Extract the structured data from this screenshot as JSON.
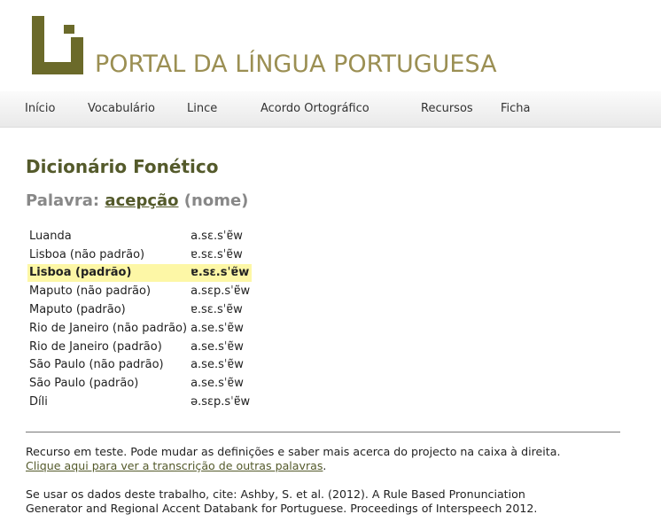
{
  "header": {
    "site_title": "PORTAL DA LÍNGUA PORTUGUESA",
    "brand_color": "#6b6a2a",
    "title_color": "#9b8f53"
  },
  "nav": {
    "items": [
      {
        "label": "Início"
      },
      {
        "label": "Vocabulário"
      },
      {
        "label": "Lince"
      },
      {
        "label": "Acordo Ortográfico"
      },
      {
        "label": "Recursos"
      },
      {
        "label": "Ficha"
      }
    ]
  },
  "main": {
    "page_title": "Dicionário Fonético",
    "word_label": "Palavra:",
    "word": "acepção",
    "word_class": "(nome)",
    "rows": [
      {
        "region": "Luanda",
        "transcription": "a.sɛ.sˈɐ̃w"
      },
      {
        "region": "Lisboa (não padrão)",
        "transcription": "ɐ.sɛ.sˈɐ̃w"
      },
      {
        "region": "Lisboa (padrão)",
        "transcription": "ɐ.sɛ.sˈɐ̃w",
        "highlighted": true
      },
      {
        "region": "Maputo (não padrão)",
        "transcription": "a.sɛp.sˈɐ̃w"
      },
      {
        "region": "Maputo (padrão)",
        "transcription": "ɐ.sɛ.sˈɐ̃w"
      },
      {
        "region": "Rio de Janeiro (não padrão)",
        "transcription": "a.se.sˈɐ̃w"
      },
      {
        "region": "Rio de Janeiro (padrão)",
        "transcription": "a.se.sˈɐ̃w"
      },
      {
        "region": "São Paulo (não padrão)",
        "transcription": "a.se.sˈɐ̃w"
      },
      {
        "region": "São Paulo (padrão)",
        "transcription": "a.se.sˈɐ̃w"
      },
      {
        "region": "Díli",
        "transcription": "ə.sɛp.sˈɐ̃w"
      }
    ],
    "highlight_color": "#fdf7a6"
  },
  "footer": {
    "note": "Recurso em teste. Pode mudar as definições e saber mais acerca do projecto na caixa à direita.",
    "link_text": "Clique aqui para ver a transcrição de outras palavras",
    "link_suffix": ".",
    "cite_line1": "Se usar os dados deste trabalho, cite: Ashby, S. et al. (2012). A Rule Based Pronunciation",
    "cite_line2": "Generator and Regional Accent Databank for Portuguese. Proceedings of Interspeech 2012."
  }
}
